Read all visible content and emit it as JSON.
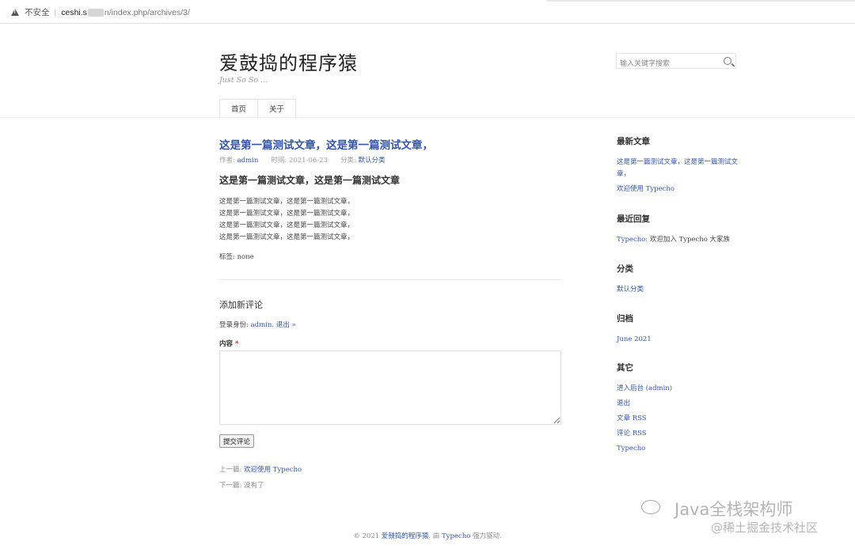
{
  "browser": {
    "security_label": "不安全",
    "url_host": "ceshi.s",
    "url_tail": "n/index.php/archives/3/"
  },
  "header": {
    "site_title": "爱鼓捣的程序猿",
    "site_desc": "Just So So ...",
    "search_placeholder": "输入关键字搜索",
    "nav": [
      "首页",
      "关于"
    ]
  },
  "post": {
    "title": "这是第一篇测试文章，这是第一篇测试文章，",
    "meta": {
      "author_label": "作者: ",
      "author": "admin",
      "time_label": "时间: ",
      "time": "2021-06-23",
      "category_label": "分类: ",
      "category": "默认分类"
    },
    "heading": "这是第一篇测试文章，这是第一篇测试文章",
    "body_lines": [
      "这是第一篇测试文章，这是第一篇测试文章，",
      "这是第一篇测试文章，这是第一篇测试文章，",
      "这是第一篇测试文章，这是第一篇测试文章，",
      "这是第一篇测试文章，这是第一篇测试文章，"
    ],
    "tags": "标签: none"
  },
  "comment": {
    "heading": "添加新评论",
    "login_prefix": "登录身份: ",
    "login_user": "admin",
    "logout": "退出 »",
    "content_label": "内容",
    "required_mark": "*",
    "submit": "提交评论"
  },
  "post_nav": {
    "prev_label": "上一篇: ",
    "prev_link": "欢迎使用 Typecho",
    "next_label": "下一篇: ",
    "next_text": "没有了"
  },
  "sidebar": {
    "recent_posts": {
      "title": "最新文章",
      "items": [
        "这是第一篇测试文章，这是第一篇测试文章，",
        "欢迎使用 Typecho"
      ]
    },
    "recent_comments": {
      "title": "最近回复",
      "author": "Typecho",
      "text": ": 欢迎加入 Typecho 大家族"
    },
    "categories": {
      "title": "分类",
      "items": [
        "默认分类"
      ]
    },
    "archives": {
      "title": "归档",
      "items": [
        "June 2021"
      ]
    },
    "other": {
      "title": "其它",
      "items": [
        "进入后台 (admin)",
        "退出",
        "文章 RSS",
        "评论 RSS",
        "Typecho"
      ]
    }
  },
  "footer": {
    "copyright": "© 2021 ",
    "site_link": "爱鼓捣的程序猿",
    "by": ". 由 ",
    "powered_link": "Typecho",
    "suffix": " 强力驱动."
  },
  "watermark": {
    "title": "Java全栈架构师",
    "sub": "@稀土掘金技术社区"
  }
}
